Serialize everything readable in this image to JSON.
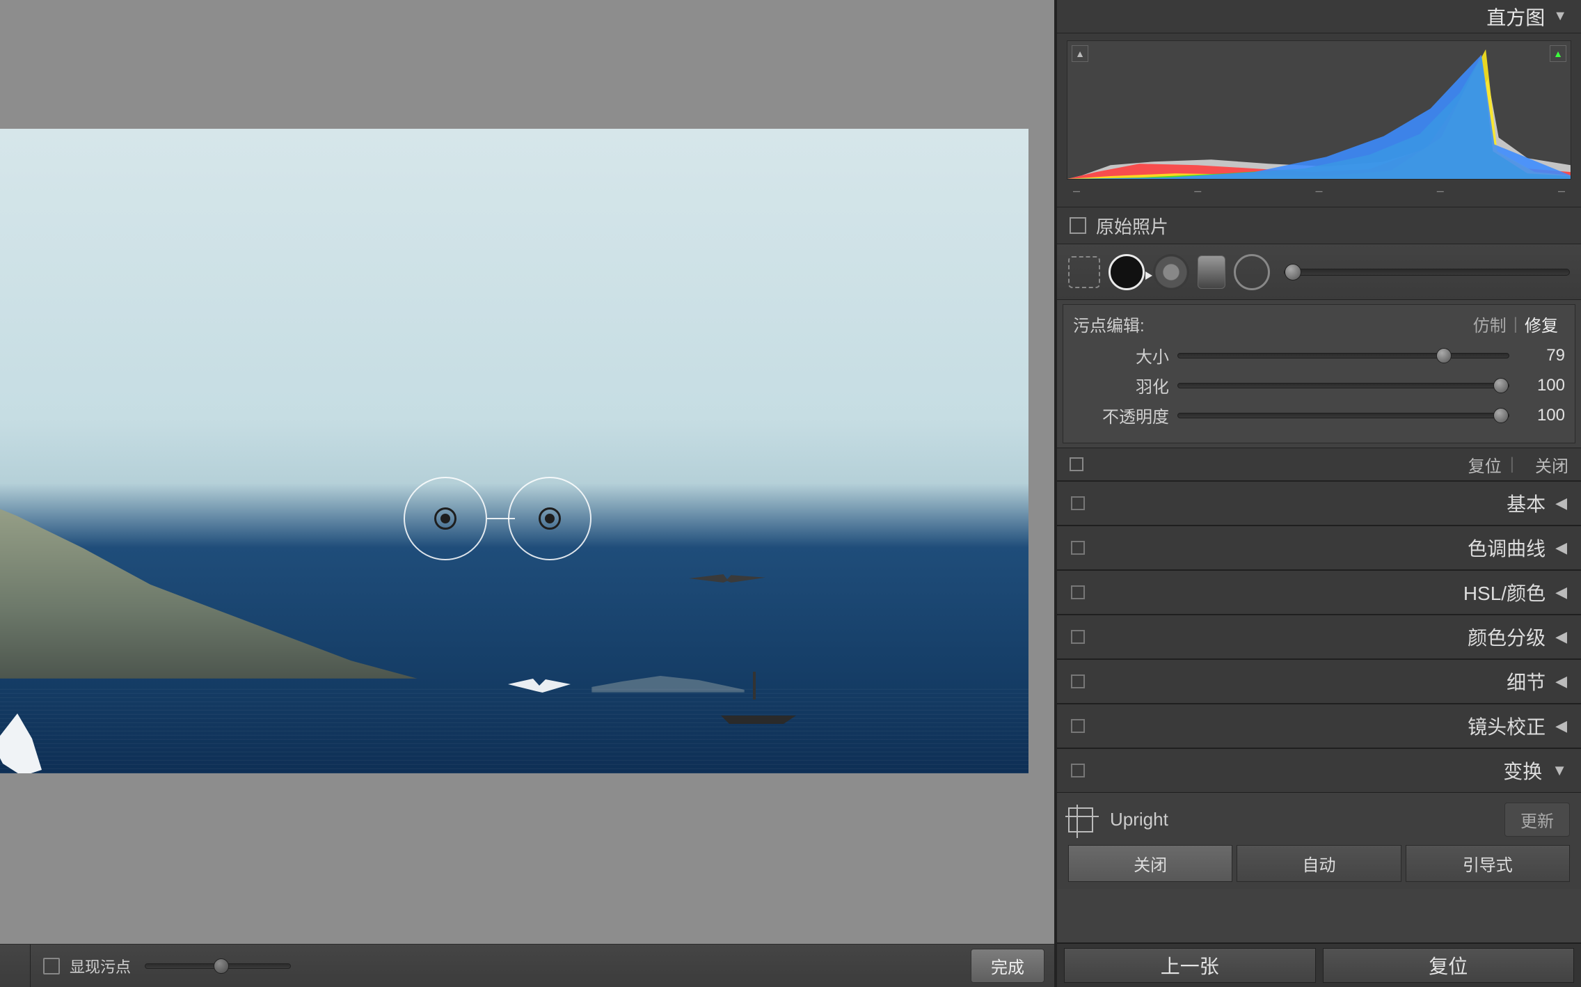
{
  "panel": {
    "histogram_title": "直方图",
    "original_label": "原始照片",
    "spot_edit_label": "污点编辑:",
    "spot_mode_clone": "仿制",
    "spot_mode_heal": "修复",
    "sliders": {
      "size_label": "大小",
      "size_value": "79",
      "size_pct": 79,
      "feather_label": "羽化",
      "feather_value": "100",
      "feather_pct": 100,
      "opacity_label": "不透明度",
      "opacity_value": "100",
      "opacity_pct": 100
    },
    "footer_reset": "复位",
    "footer_close": "关闭",
    "sections": [
      {
        "label": "基本",
        "expanded": false
      },
      {
        "label": "色调曲线",
        "expanded": false
      },
      {
        "label": "HSL/颜色",
        "expanded": false
      },
      {
        "label": "颜色分级",
        "expanded": false
      },
      {
        "label": "细节",
        "expanded": false
      },
      {
        "label": "镜头校正",
        "expanded": false
      },
      {
        "label": "变换",
        "expanded": true
      }
    ],
    "transform": {
      "upright_label": "Upright",
      "update_label": "更新",
      "buttons": {
        "off": "关闭",
        "auto": "自动",
        "guided": "引导式"
      }
    },
    "actions": {
      "prev": "上一张",
      "reset": "复位"
    }
  },
  "toolbar": {
    "show_spots_label": "显现污点",
    "done_label": "完成"
  }
}
